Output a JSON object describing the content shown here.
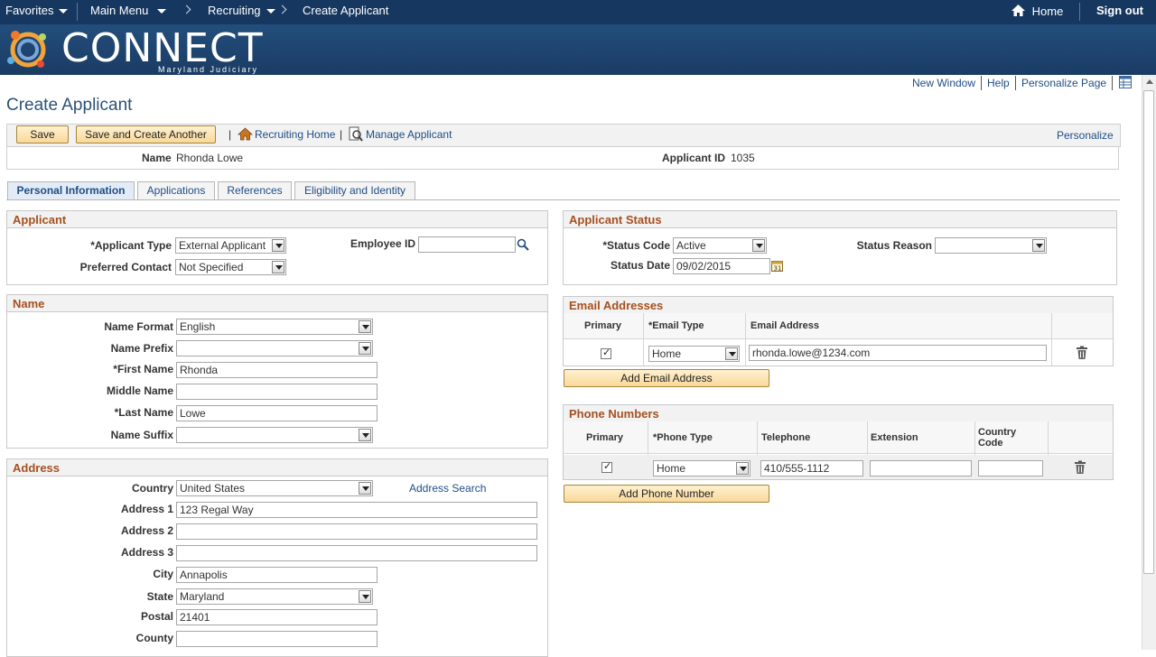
{
  "topnav": {
    "favorites": "Favorites",
    "main_menu": "Main Menu",
    "recruiting": "Recruiting",
    "create_applicant": "Create Applicant",
    "home": "Home",
    "sign_out": "Sign out"
  },
  "brand": {
    "name": "CONNECT",
    "sub": "Maryland Judiciary"
  },
  "page_links": {
    "new_window": "New Window",
    "help": "Help",
    "personalize_page": "Personalize Page"
  },
  "page_title": "Create Applicant",
  "toolbar": {
    "save": "Save",
    "save_create_another": "Save and Create Another",
    "divider": "|",
    "recruiting_home": "Recruiting Home",
    "divider2": "|",
    "manage_applicant": "Manage Applicant",
    "personalize": "Personalize"
  },
  "summary": {
    "name_label": "Name",
    "name_value": "Rhonda Lowe",
    "id_label": "Applicant ID",
    "id_value": "1035"
  },
  "tabs": [
    "Personal Information",
    "Applications",
    "References",
    "Eligibility and Identity"
  ],
  "applicant": {
    "title": "Applicant",
    "type_label": "*Applicant Type",
    "type_value": "External Applicant",
    "contact_label": "Preferred Contact",
    "contact_value": "Not Specified",
    "employee_id_label": "Employee ID",
    "employee_id_value": ""
  },
  "status": {
    "title": "Applicant Status",
    "code_label": "*Status Code",
    "code_value": "Active",
    "reason_label": "Status Reason",
    "reason_value": "",
    "date_label": "Status Date",
    "date_value": "09/02/2015"
  },
  "name": {
    "title": "Name",
    "format_label": "Name Format",
    "format_value": "English",
    "prefix_label": "Name Prefix",
    "prefix_value": "",
    "first_label": "*First Name",
    "first_value": "Rhonda",
    "middle_label": "Middle Name",
    "middle_value": "",
    "last_label": "*Last Name",
    "last_value": "Lowe",
    "suffix_label": "Name Suffix",
    "suffix_value": ""
  },
  "address": {
    "title": "Address",
    "country_label": "Country",
    "country_value": "United States",
    "search_link": "Address Search",
    "a1_label": "Address 1",
    "a1_value": "123 Regal Way",
    "a2_label": "Address 2",
    "a2_value": "",
    "a3_label": "Address 3",
    "a3_value": "",
    "city_label": "City",
    "city_value": "Annapolis",
    "state_label": "State",
    "state_value": "Maryland",
    "postal_label": "Postal",
    "postal_value": "21401",
    "county_label": "County",
    "county_value": ""
  },
  "email": {
    "title": "Email Addresses",
    "col_primary": "Primary",
    "col_type": "*Email Type",
    "col_address": "Email Address",
    "type_value": "Home",
    "address_value": "rhonda.lowe@1234.com",
    "add_button": "Add Email Address"
  },
  "phone": {
    "title": "Phone Numbers",
    "col_primary": "Primary",
    "col_type": "*Phone Type",
    "col_tel": "Telephone",
    "col_ext": "Extension",
    "col_country": "Country Code",
    "type_value": "Home",
    "tel_value": "410/555-1112",
    "ext_value": "",
    "country_value": "",
    "add_button": "Add Phone Number"
  }
}
